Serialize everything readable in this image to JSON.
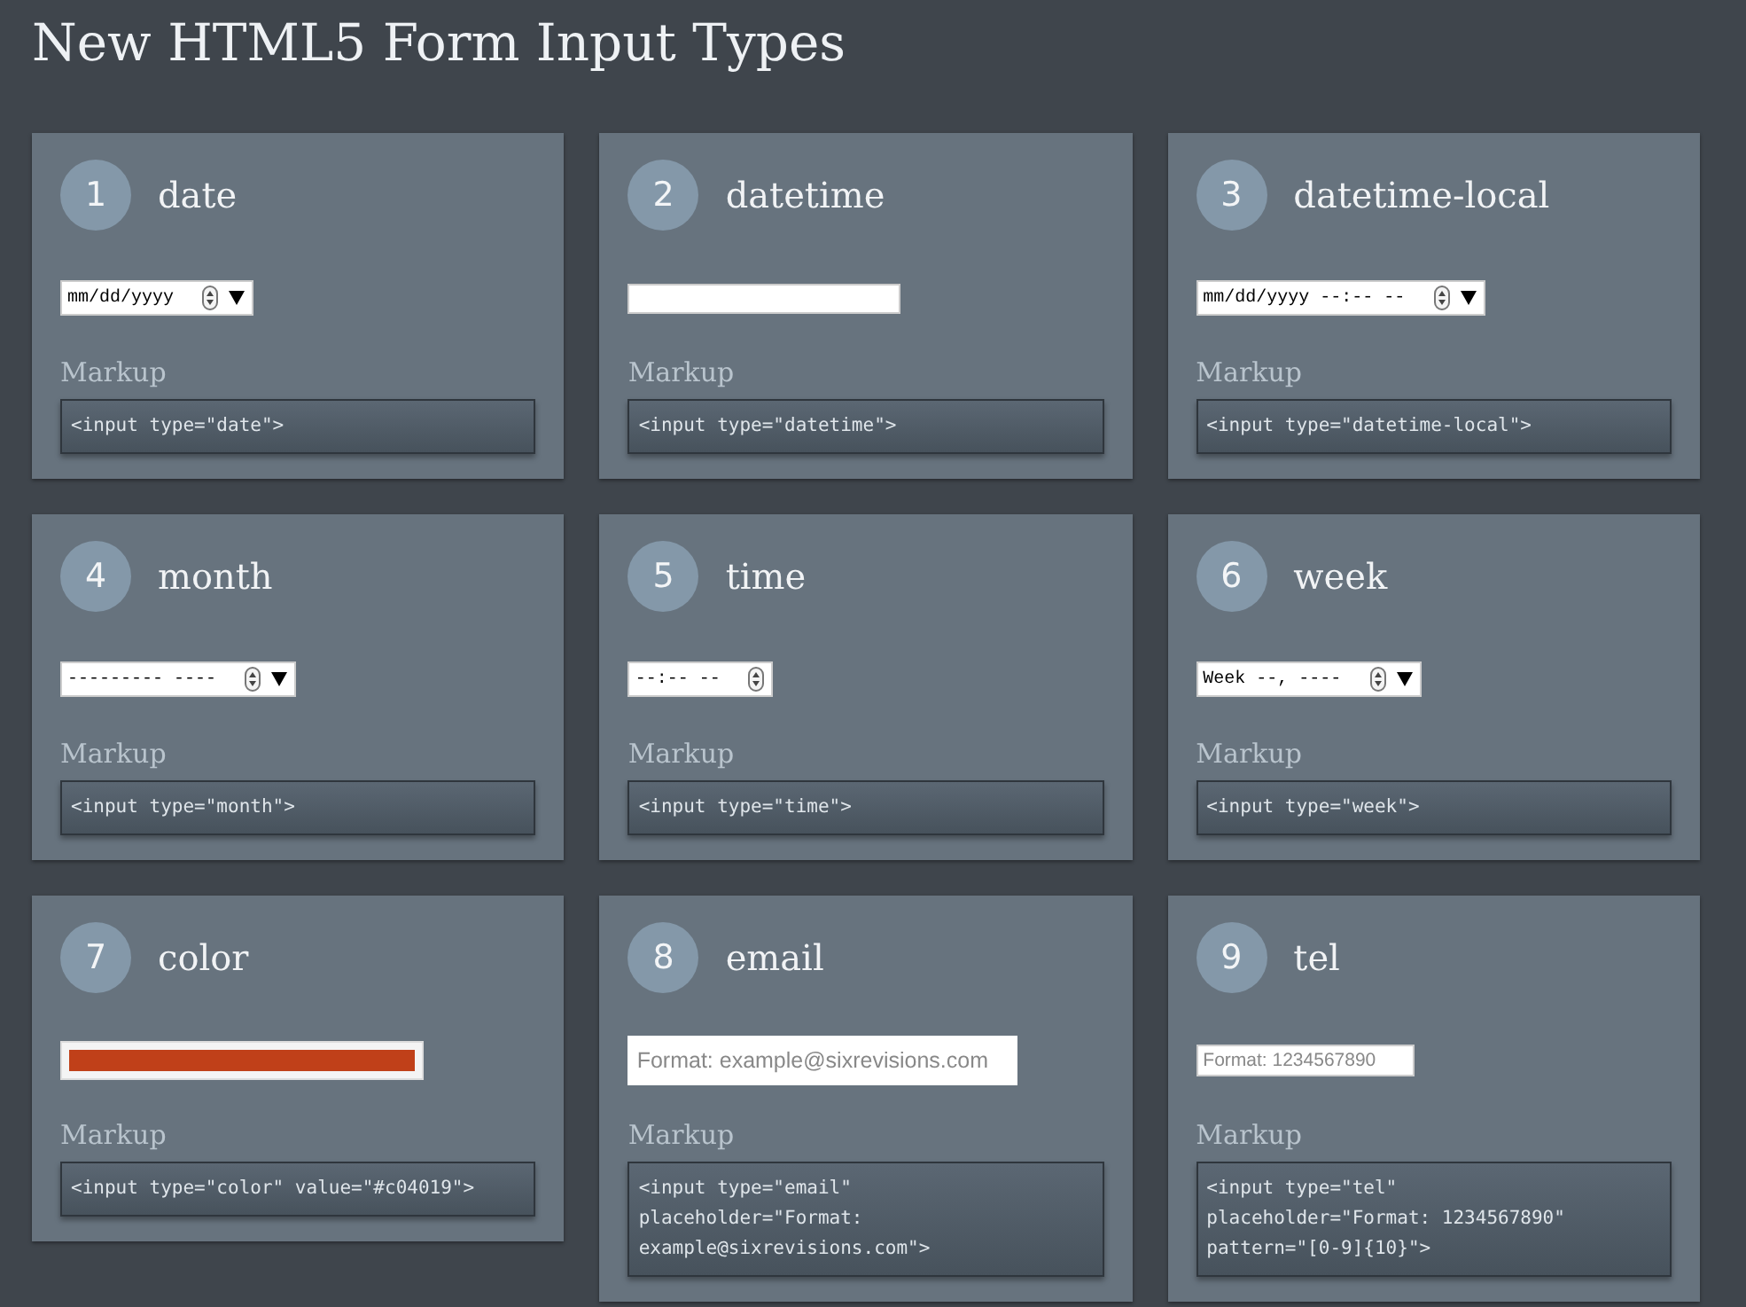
{
  "page_title": "New HTML5 Form Input Types",
  "cards": [
    {
      "number": "1",
      "title": "date",
      "input": {
        "kind": "spinner",
        "value": "mm/dd/yyyy",
        "dropdown": true
      },
      "markup_label": "Markup",
      "markup": [
        "<input type=\"date\">"
      ]
    },
    {
      "number": "2",
      "title": "datetime",
      "input": {
        "kind": "text"
      },
      "markup_label": "Markup",
      "markup": [
        "<input type=\"datetime\">"
      ]
    },
    {
      "number": "3",
      "title": "datetime-local",
      "input": {
        "kind": "spinner",
        "value": "mm/dd/yyyy --:-- --",
        "dropdown": true
      },
      "markup_label": "Markup",
      "markup": [
        "<input type=\"datetime-local\">"
      ]
    },
    {
      "number": "4",
      "title": "month",
      "input": {
        "kind": "spinner",
        "value": "--------- ----",
        "dropdown": true
      },
      "markup_label": "Markup",
      "markup": [
        "<input type=\"month\">"
      ]
    },
    {
      "number": "5",
      "title": "time",
      "input": {
        "kind": "spinner",
        "value": "--:-- --",
        "dropdown": false
      },
      "markup_label": "Markup",
      "markup": [
        "<input type=\"time\">"
      ]
    },
    {
      "number": "6",
      "title": "week",
      "input": {
        "kind": "spinner",
        "value": "Week --, ----",
        "dropdown": true
      },
      "markup_label": "Markup",
      "markup": [
        "<input type=\"week\">"
      ]
    },
    {
      "number": "7",
      "title": "color",
      "input": {
        "kind": "color",
        "color": "#c04019"
      },
      "markup_label": "Markup",
      "markup": [
        "<input type=\"color\" value=\"#c04019\">"
      ]
    },
    {
      "number": "8",
      "title": "email",
      "input": {
        "kind": "email",
        "placeholder": "Format: example@sixrevisions.com"
      },
      "markup_label": "Markup",
      "markup": [
        "<input type=\"email\"",
        "placeholder=\"Format:",
        "example@sixrevisions.com\">"
      ]
    },
    {
      "number": "9",
      "title": "tel",
      "input": {
        "kind": "tel",
        "placeholder": "Format: 1234567890"
      },
      "markup_label": "Markup",
      "markup": [
        "<input type=\"tel\"",
        "placeholder=\"Format: 1234567890\"",
        "pattern=\"[0-9]{10}\">"
      ]
    }
  ]
}
